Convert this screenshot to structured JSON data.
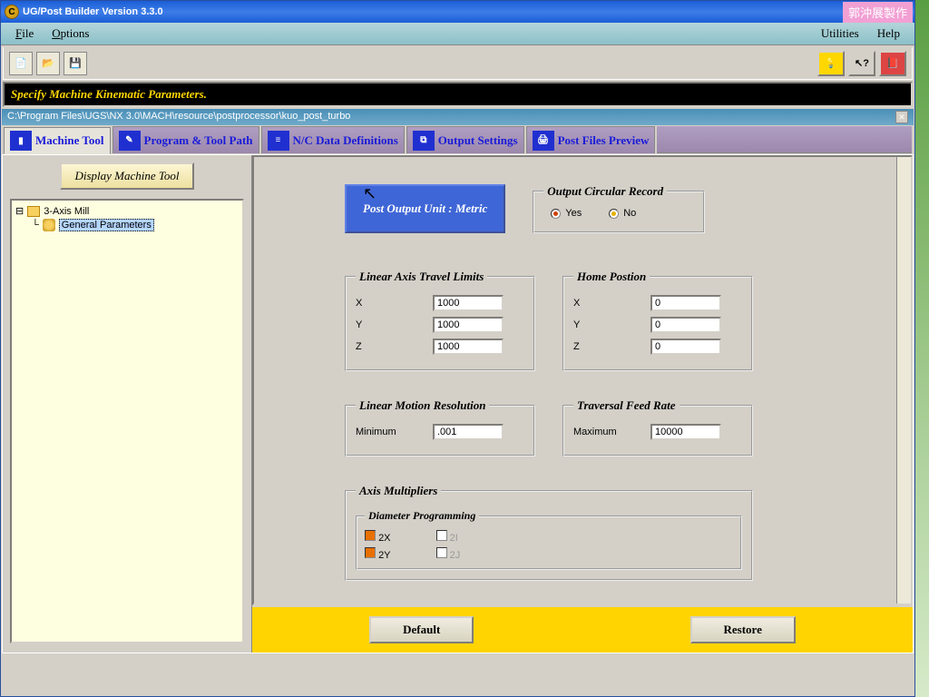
{
  "window": {
    "title": "UG/Post Builder Version 3.3.0"
  },
  "badge": "郭沖展製作",
  "menu": {
    "file": "File",
    "options": "Options",
    "utilities": "Utilities",
    "help": "Help"
  },
  "status": "Specify Machine Kinematic Parameters.",
  "path": "C:\\Program Files\\UGS\\NX 3.0\\MACH\\resource\\postprocessor\\kuo_post_turbo",
  "tabs": {
    "machine": "Machine Tool",
    "program": "Program & Tool Path",
    "nc": "N/C Data Definitions",
    "output": "Output Settings",
    "preview": "Post Files Preview"
  },
  "left": {
    "display_btn": "Display Machine Tool",
    "root": "3-Axis Mill",
    "child": "General Parameters"
  },
  "form": {
    "post_unit": "Post Output Unit : Metric",
    "circular": {
      "title": "Output Circular Record",
      "yes": "Yes",
      "no": "No"
    },
    "linear_limits": {
      "title": "Linear Axis Travel Limits",
      "x": "X",
      "y": "Y",
      "z": "Z",
      "xv": "1000",
      "yv": "1000",
      "zv": "1000"
    },
    "home": {
      "title": "Home Postion",
      "x": "X",
      "y": "Y",
      "z": "Z",
      "xv": "0",
      "yv": "0",
      "zv": "0"
    },
    "resolution": {
      "title": "Linear Motion Resolution",
      "min_label": "Minimum",
      "min_val": ".001"
    },
    "feed": {
      "title": "Traversal Feed Rate",
      "max_label": "Maximum",
      "max_val": "10000"
    },
    "axis_mult": {
      "title": "Axis Multipliers",
      "diam": "Diameter Programming",
      "x2": "2X",
      "y2": "2Y",
      "i2": "2I",
      "j2": "2J"
    },
    "default_btn": "Default",
    "restore_btn": "Restore"
  }
}
